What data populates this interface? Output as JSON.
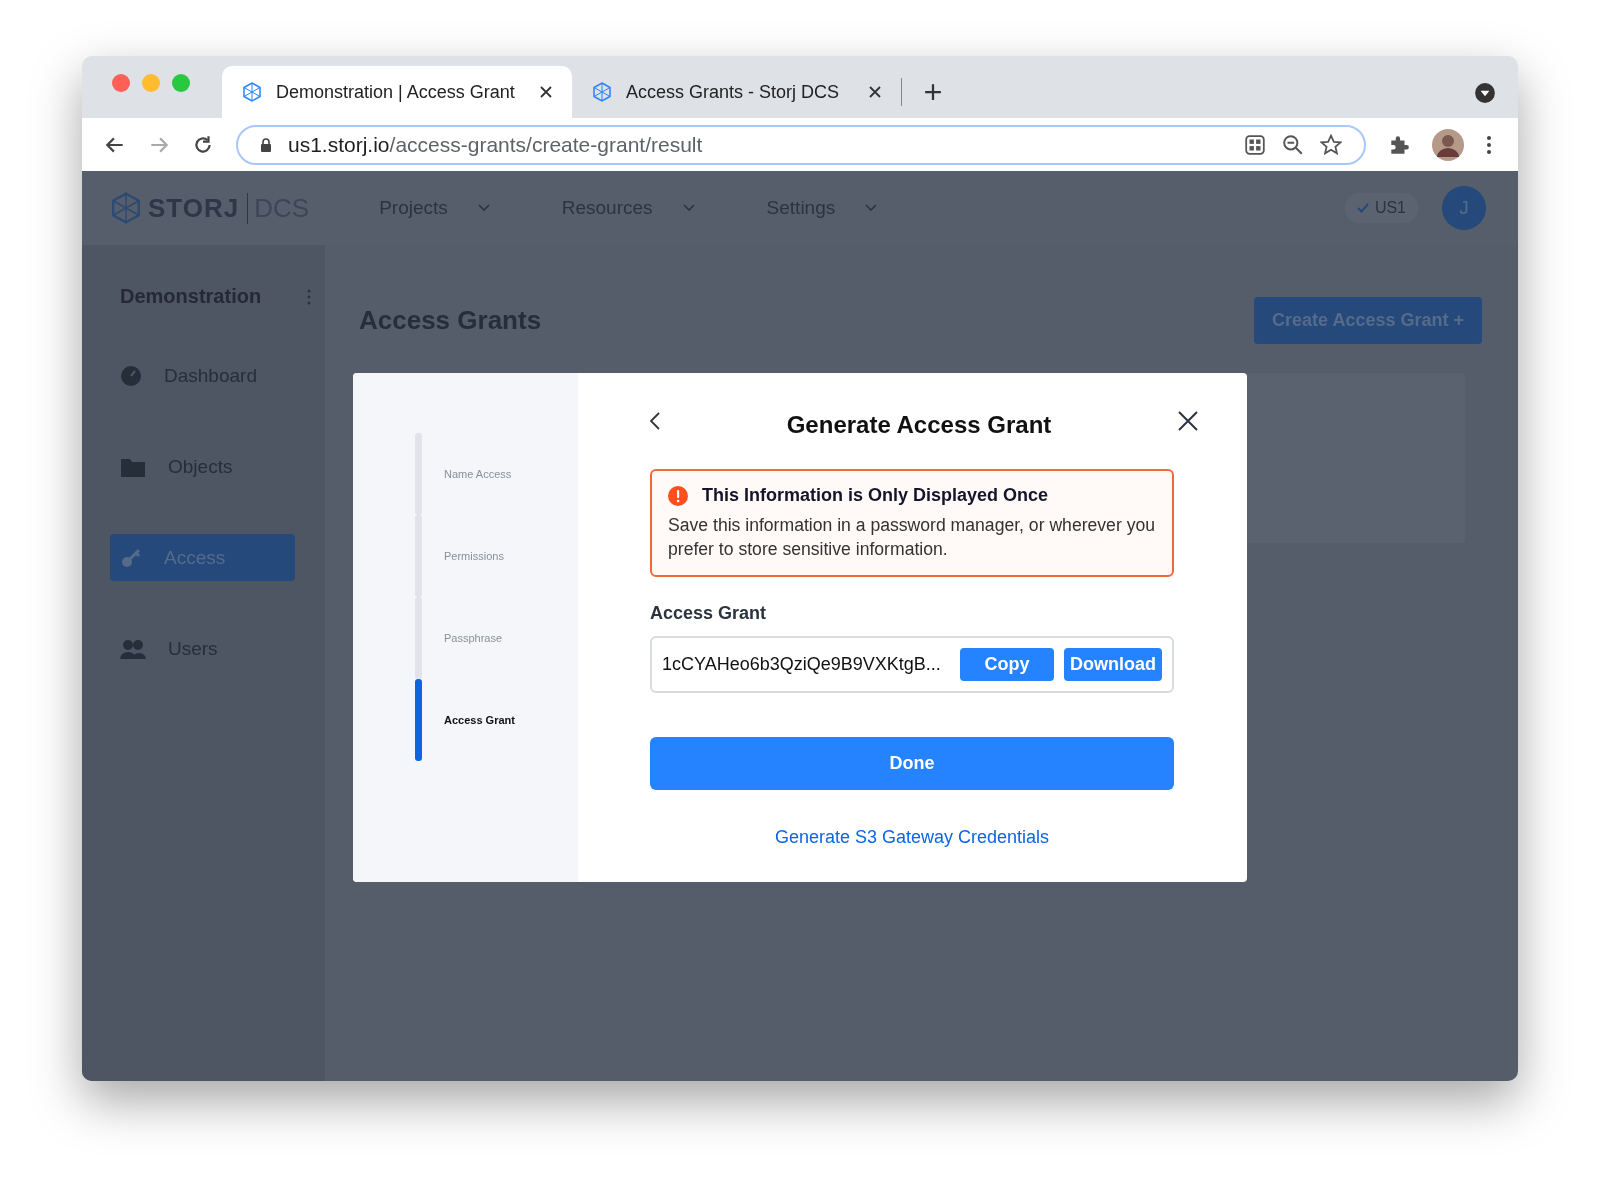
{
  "browser": {
    "tabs": [
      {
        "title": "Demonstration | Access Grant",
        "selected": true
      },
      {
        "title": "Access Grants - Storj DCS",
        "selected": false
      }
    ],
    "url": {
      "host": "us1.storj.io",
      "path": "/access-grants/create-grant/result"
    }
  },
  "header": {
    "brand": "STORJ",
    "product": "DCS",
    "nav": [
      {
        "label": "Projects"
      },
      {
        "label": "Resources"
      },
      {
        "label": "Settings"
      }
    ],
    "region": "US1",
    "user_initial": "J"
  },
  "sidebar": {
    "project": "Demonstration",
    "items": [
      {
        "label": "Dashboard",
        "kind": "gauge",
        "selected": false
      },
      {
        "label": "Objects",
        "kind": "folder",
        "selected": false
      },
      {
        "label": "Access",
        "kind": "key",
        "selected": true
      },
      {
        "label": "Users",
        "kind": "users",
        "selected": false
      }
    ]
  },
  "page": {
    "title": "Access Grants",
    "create_button": "Create Access Grant +"
  },
  "modal": {
    "steps": [
      {
        "label": "Name Access",
        "selected": false
      },
      {
        "label": "Permissions",
        "selected": false
      },
      {
        "label": "Passphrase",
        "selected": false
      },
      {
        "label": "Access Grant",
        "selected": true
      }
    ],
    "title": "Generate Access Grant",
    "warning": {
      "title": "This Information is Only Displayed Once",
      "body": "Save this information in a password manager, or wherever you prefer to store sensitive information."
    },
    "field_label": "Access Grant",
    "grant_value": "1cCYAHeo6b3QziQe9B9VXKtgB...",
    "copy": "Copy",
    "download": "Download",
    "done": "Done",
    "link": "Generate S3 Gateway Credentials"
  }
}
